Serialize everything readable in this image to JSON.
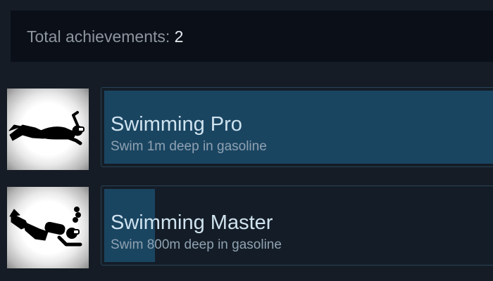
{
  "header": {
    "label": "Total achievements:",
    "count": "2"
  },
  "achievements": [
    {
      "title": "Swimming Pro",
      "description": "Swim 1m deep in gasoline",
      "icon": "swimmer-icon",
      "progress": 1.0
    },
    {
      "title": "Swimming Master",
      "description": "Swim 800m deep in gasoline",
      "icon": "scuba-diver-icon",
      "progress": 0.13
    }
  ],
  "colors": {
    "background": "#151c25",
    "header_bg": "#0b1018",
    "progress_fill": "#1a4561",
    "panel_border": "#2a4256"
  }
}
